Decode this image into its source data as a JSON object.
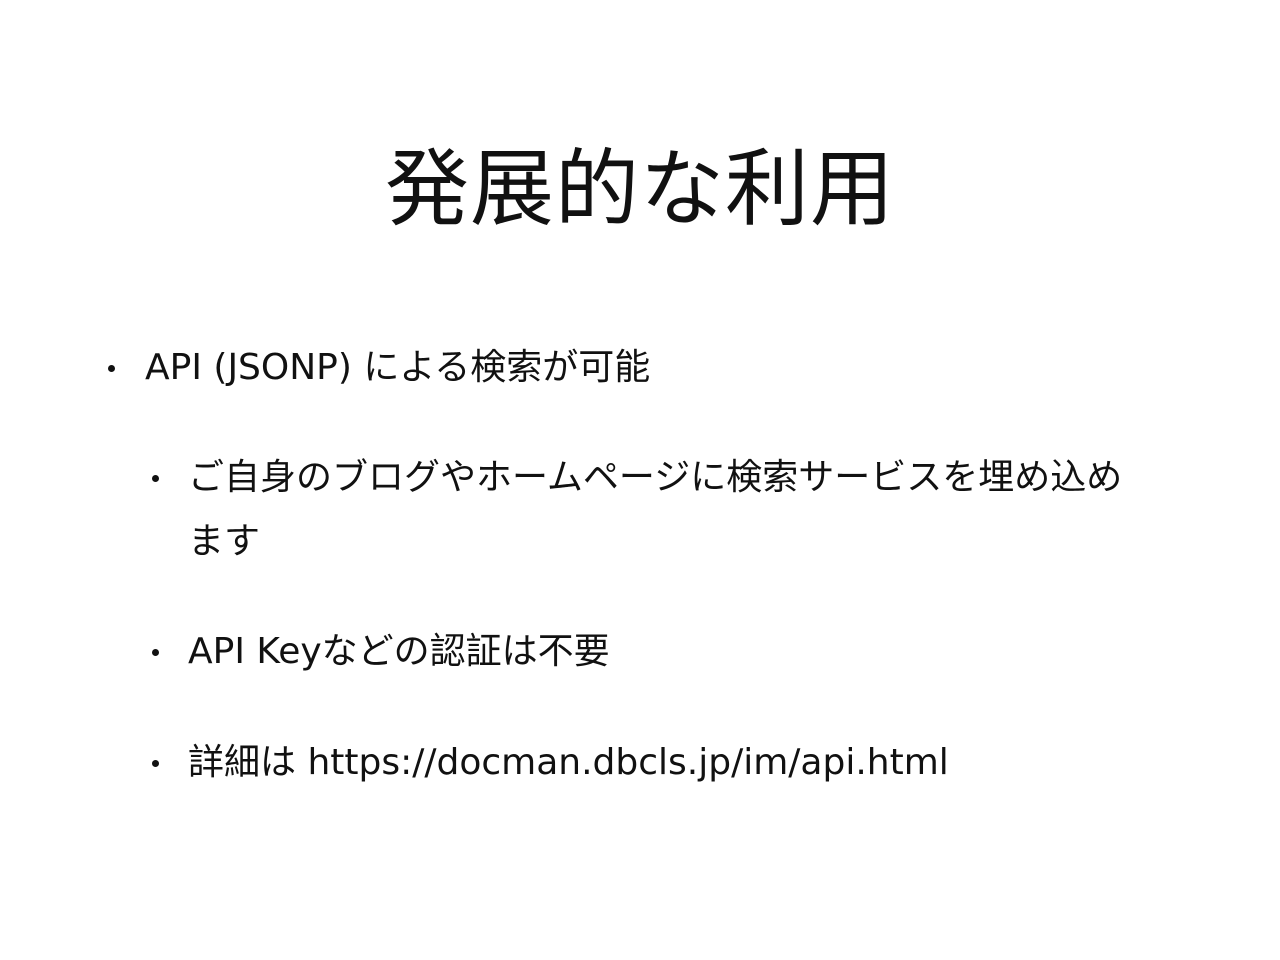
{
  "slide": {
    "title": "発展的な利用",
    "bullets": [
      {
        "level": 1,
        "text": "API (JSONP) による検索が可能"
      },
      {
        "level": 2,
        "text": "ご自身のブログやホームページに検索サービスを埋め込めます"
      },
      {
        "level": 2,
        "text": "API Keyなどの認証は不要"
      },
      {
        "level": 2,
        "text": "詳細は https://docman.dbcls.jp/im/api.html"
      }
    ]
  }
}
